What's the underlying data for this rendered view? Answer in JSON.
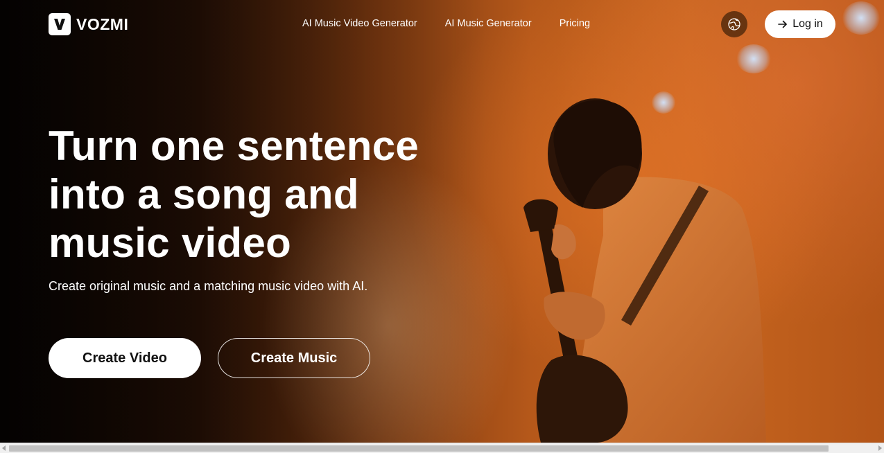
{
  "brand": {
    "name": "VOZMI"
  },
  "nav": {
    "items": [
      {
        "label": "AI Music Video Generator"
      },
      {
        "label": "AI Music Generator"
      },
      {
        "label": "Pricing"
      }
    ],
    "language_icon": "globe-icon",
    "login_icon": "arrow-right-icon",
    "login_label": "Log in"
  },
  "hero": {
    "headline_lines": [
      "Turn one sentence",
      "into a song and",
      "music video"
    ],
    "subheadline": "Create original music and a matching music video with AI.",
    "primary_cta": "Create Video",
    "secondary_cta": "Create Music"
  },
  "colors": {
    "accent": "#c7661f",
    "text_on_dark": "#ffffff",
    "button_bg": "#ffffff"
  }
}
